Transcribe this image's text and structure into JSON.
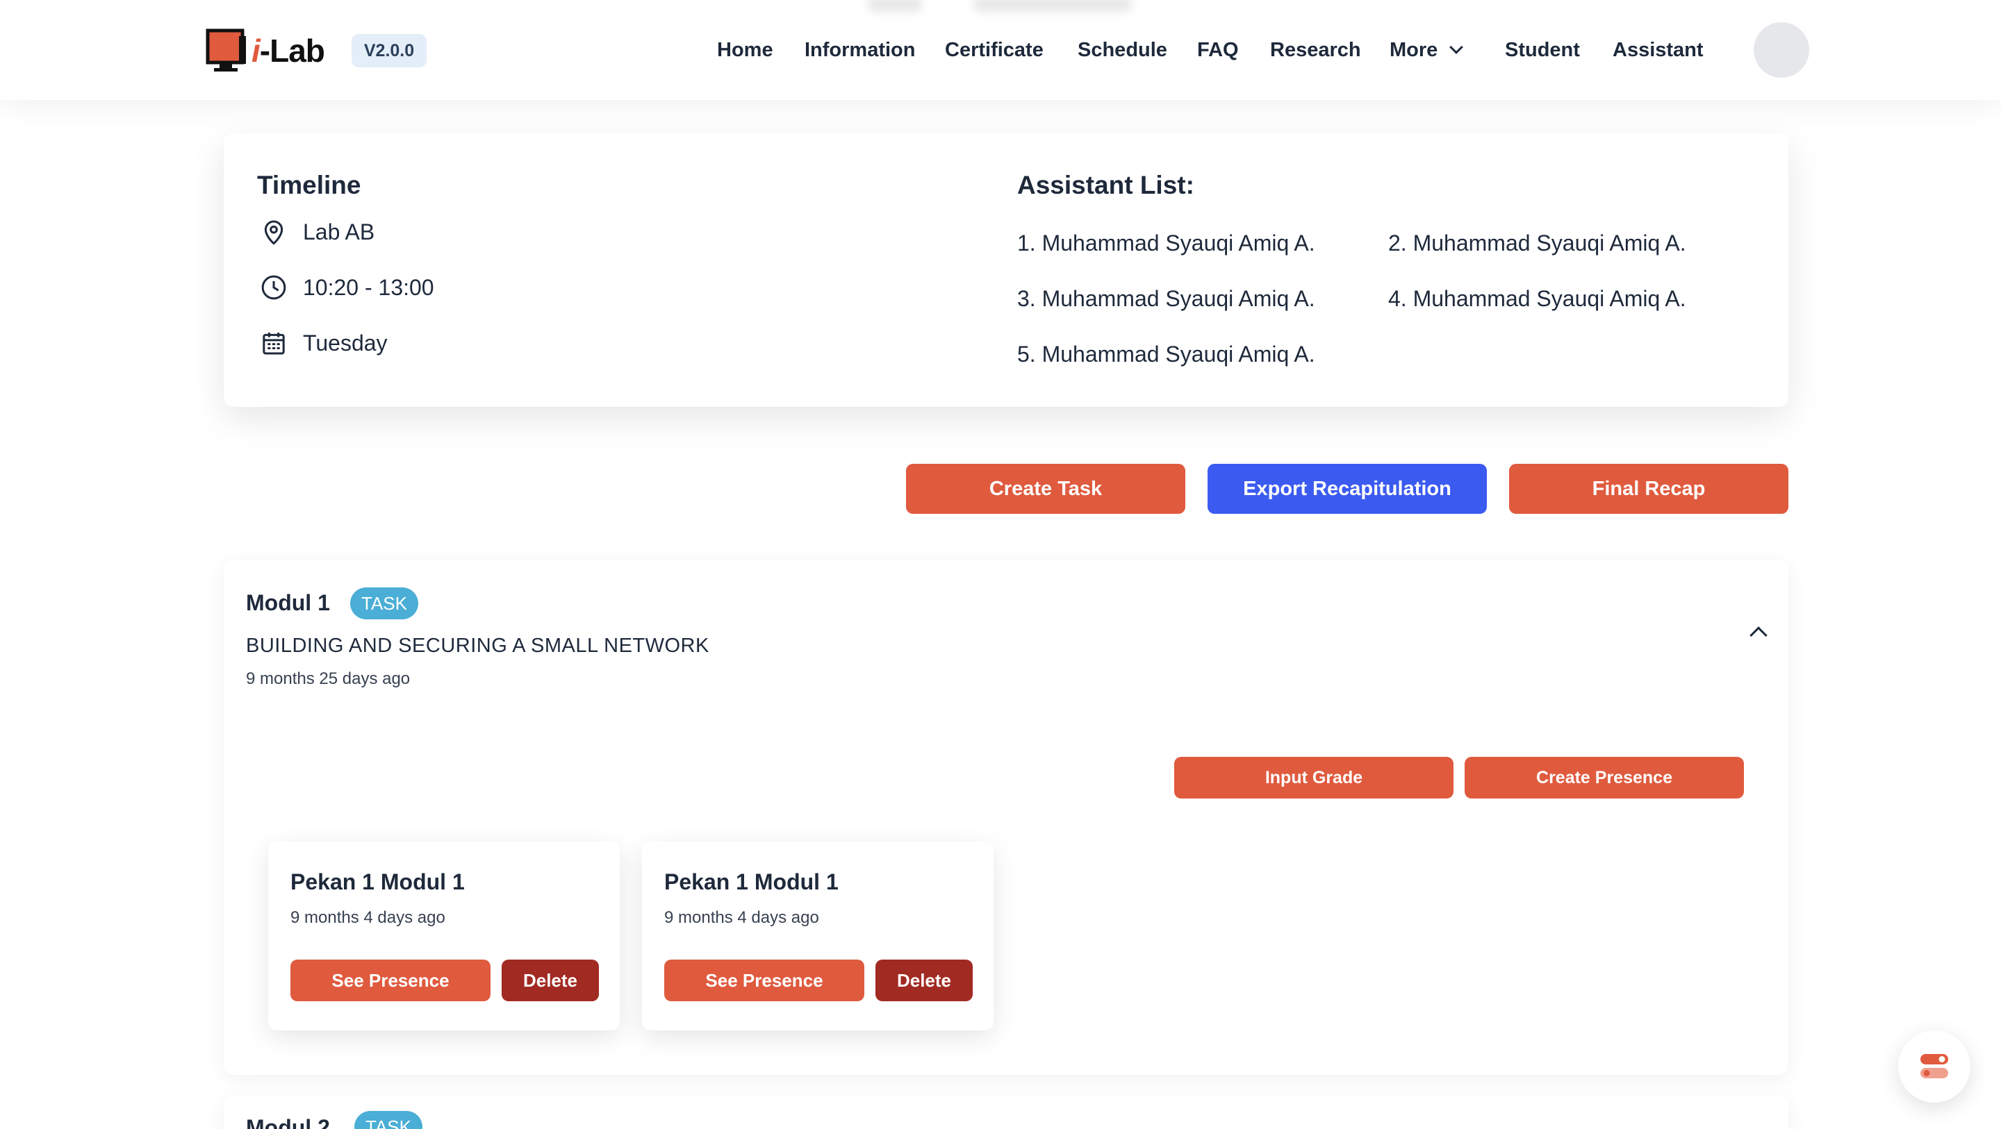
{
  "app": {
    "logo_text_i": "i",
    "logo_text_rest": "-Lab",
    "version": "V2.0.0"
  },
  "nav": {
    "items": [
      "Home",
      "Information",
      "Certificate",
      "Schedule",
      "FAQ",
      "Research",
      "More",
      "Student",
      "Assistant"
    ]
  },
  "timeline": {
    "title": "Timeline",
    "location": "Lab AB",
    "time": "10:20 - 13:00",
    "day": "Tuesday"
  },
  "assistants": {
    "title": "Assistant List:",
    "items": [
      "1. Muhammad Syauqi Amiq A.",
      "2. Muhammad Syauqi Amiq A.",
      "3. Muhammad Syauqi Amiq A.",
      "4. Muhammad Syauqi Amiq A.",
      "5. Muhammad Syauqi Amiq A."
    ]
  },
  "actions": {
    "create_task": "Create Task",
    "export": "Export Recapitulation",
    "final_recap": "Final Recap"
  },
  "modul1": {
    "title": "Modul 1",
    "badge": "TASK",
    "subtitle": "BUILDING AND SECURING A SMALL NETWORK",
    "time": "9 months 25 days ago",
    "input_grade": "Input Grade",
    "create_presence": "Create Presence",
    "meetings": [
      {
        "title": "Pekan 1 Modul 1",
        "time": "9 months 4 days ago",
        "see": "See Presence",
        "delete": "Delete"
      },
      {
        "title": "Pekan 1 Modul 1",
        "time": "9 months 4 days ago",
        "see": "See Presence",
        "delete": "Delete"
      }
    ]
  },
  "modul2": {
    "title": "Modul 2",
    "badge": "TASK"
  },
  "colors": {
    "accent_red": "#e05a3e",
    "accent_blue": "#3b5bf0",
    "danger_dark": "#a12a22",
    "badge_blue": "#4aaed6"
  }
}
